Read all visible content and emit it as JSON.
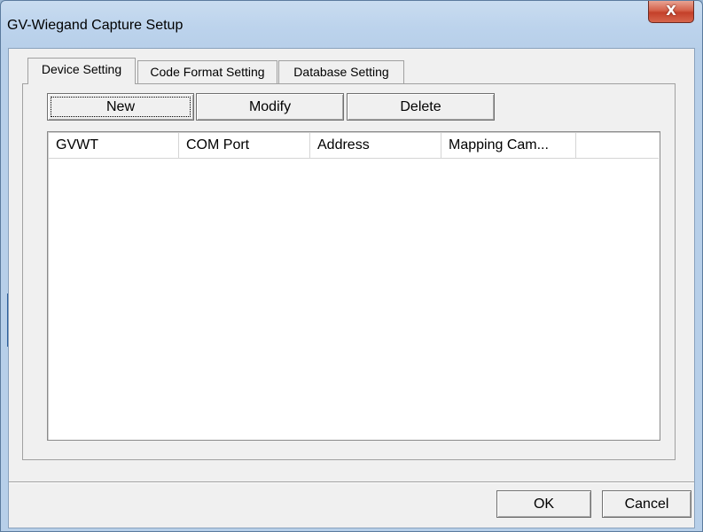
{
  "window": {
    "title": "GV-Wiegand Capture Setup",
    "close_icon": "X"
  },
  "tabs": [
    {
      "label": "Device Setting",
      "active": true
    },
    {
      "label": "Code Format Setting",
      "active": false
    },
    {
      "label": "Database Setting",
      "active": false
    }
  ],
  "toolbar": {
    "new_label": "New",
    "modify_label": "Modify",
    "delete_label": "Delete"
  },
  "device_table": {
    "columns": [
      "GVWT",
      "COM Port",
      "Address",
      "Mapping Cam..."
    ],
    "rows": []
  },
  "footer": {
    "ok_label": "OK",
    "cancel_label": "Cancel"
  }
}
